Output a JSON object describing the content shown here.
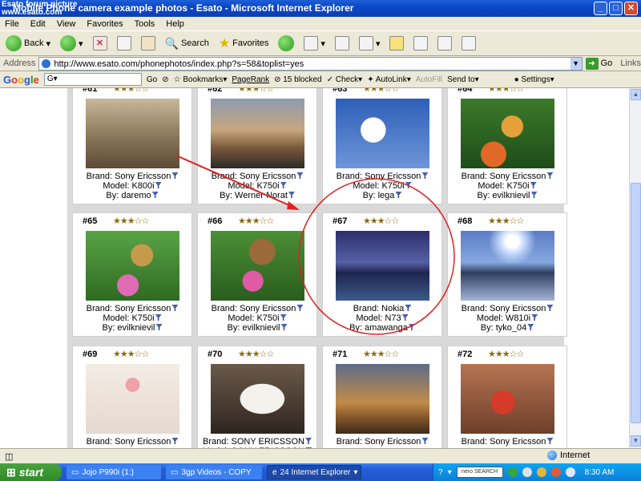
{
  "window": {
    "watermark_line1": "Esato forum picture",
    "watermark_line2": "www.esato.com",
    "title": "Mobile Phone camera example photos - Esato - Microsoft Internet Explorer"
  },
  "menu": [
    "File",
    "Edit",
    "View",
    "Favorites",
    "Tools",
    "Help"
  ],
  "toolbar": {
    "back": "Back",
    "search": "Search",
    "favorites": "Favorites"
  },
  "address": {
    "label": "Address",
    "url": "http://www.esato.com/phonephotos/index.php?s=58&toplist=yes",
    "go": "Go",
    "links": "Links"
  },
  "googlebar": {
    "logo": "Google",
    "go": "Go",
    "bookmarks": "Bookmarks",
    "pagerank": "PageRank",
    "blocked": "15 blocked",
    "check": "Check",
    "autolink": "AutoLink",
    "autofill": "AutoFill",
    "sendto": "Send to",
    "settings": "Settings"
  },
  "photos": [
    {
      "num": "#61",
      "stars": "★★★☆☆",
      "brand": "Brand: Sony Ericsson",
      "model": "Model: K800i",
      "by": "By: daremo",
      "img": "beach"
    },
    {
      "num": "#62",
      "stars": "★★★☆☆",
      "brand": "Brand: Sony Ericsson",
      "model": "Model: K750i",
      "by": "By: Werner Norat",
      "img": "sunset"
    },
    {
      "num": "#63",
      "stars": "★★★☆☆",
      "brand": "Brand: Sony Ericsson",
      "model": "Model: K750i",
      "by": "By: lega",
      "img": "blossom"
    },
    {
      "num": "#64",
      "stars": "★★★☆☆",
      "brand": "Brand: Sony Ericsson",
      "model": "Model: K750i",
      "by": "By: evilknievil",
      "img": "butterfly1"
    },
    {
      "num": "#65",
      "stars": "★★★☆☆",
      "brand": "Brand: Sony Ericsson",
      "model": "Model: K750i",
      "by": "By: evilknievil",
      "img": "butterfly2"
    },
    {
      "num": "#66",
      "stars": "★★★☆☆",
      "brand": "Brand: Sony Ericsson",
      "model": "Model: K750i",
      "by": "By: evilknievil",
      "img": "butterfly3"
    },
    {
      "num": "#67",
      "stars": "★★★☆☆",
      "brand": "Brand: Nokia",
      "model": "Model: N73",
      "by": "By: amawanga",
      "img": "bridge"
    },
    {
      "num": "#68",
      "stars": "★★★☆☆",
      "brand": "Brand: Sony Ericsson",
      "model": "Model: W810i",
      "by": "By: tyko_04",
      "img": "lake"
    },
    {
      "num": "#69",
      "stars": "★★★☆☆",
      "brand": "Brand: Sony Ericsson",
      "model": "",
      "by": "",
      "img": "cat"
    },
    {
      "num": "#70",
      "stars": "★★★☆☆",
      "brand": "Brand: SONY ERICSSON",
      "model": "Model: SONY ERICSSON",
      "by": "",
      "img": "dog"
    },
    {
      "num": "#71",
      "stars": "★★★☆☆",
      "brand": "Brand: Sony Ericsson",
      "model": "",
      "by": "",
      "img": "burj"
    },
    {
      "num": "#72",
      "stars": "★★★☆☆",
      "brand": "Brand: Sony Ericsson",
      "model": "",
      "by": "",
      "img": "strawberry"
    }
  ],
  "statusbar": {
    "zone": "Internet"
  },
  "taskbar": {
    "start": "start",
    "tasks": [
      "Jojo P990i (1:)",
      "3gp Videos - COPY",
      "24 Internet Explorer"
    ],
    "nero": "nero SEARCH",
    "clock": "8:30 AM"
  }
}
